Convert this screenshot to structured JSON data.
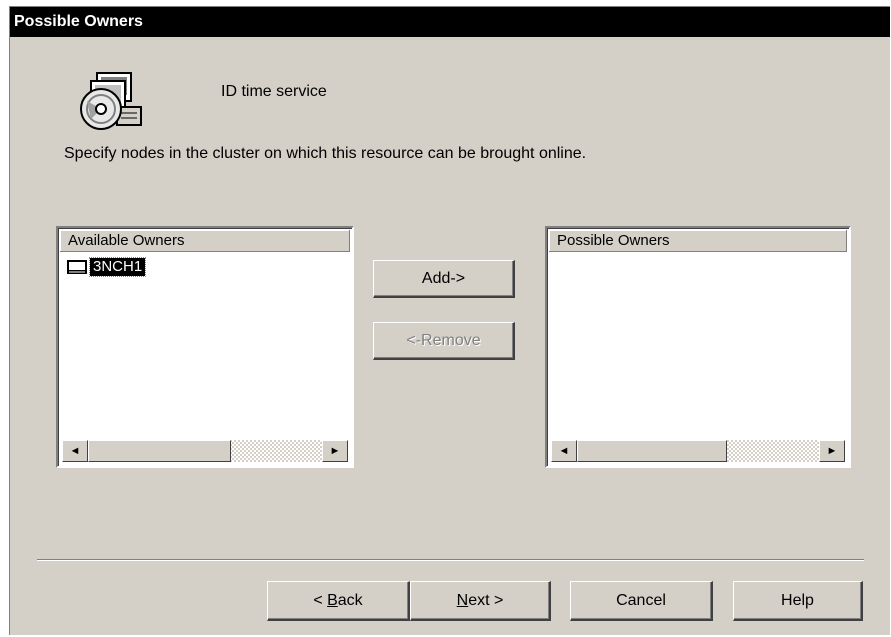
{
  "window": {
    "title": "Possible Owners"
  },
  "resource": {
    "icon": "resource-disk-icon",
    "name": "ID time service"
  },
  "instructions": "Specify nodes in the cluster on which this resource can be brought online.",
  "available_owners": {
    "header": "Available Owners",
    "items": [
      {
        "icon": "node-computer-icon",
        "label": "3NCH1",
        "selected": true
      }
    ]
  },
  "possible_owners": {
    "header": "Possible Owners",
    "items": []
  },
  "buttons": {
    "add": "Add->",
    "remove": "<-Remove",
    "back_prefix": "< ",
    "back_mnemonic": "B",
    "back_rest": "ack",
    "next_mnemonic": "N",
    "next_rest": "ext >",
    "cancel": "Cancel",
    "help": "Help"
  },
  "scroll_arrows": {
    "left": "◄",
    "right": "►"
  }
}
